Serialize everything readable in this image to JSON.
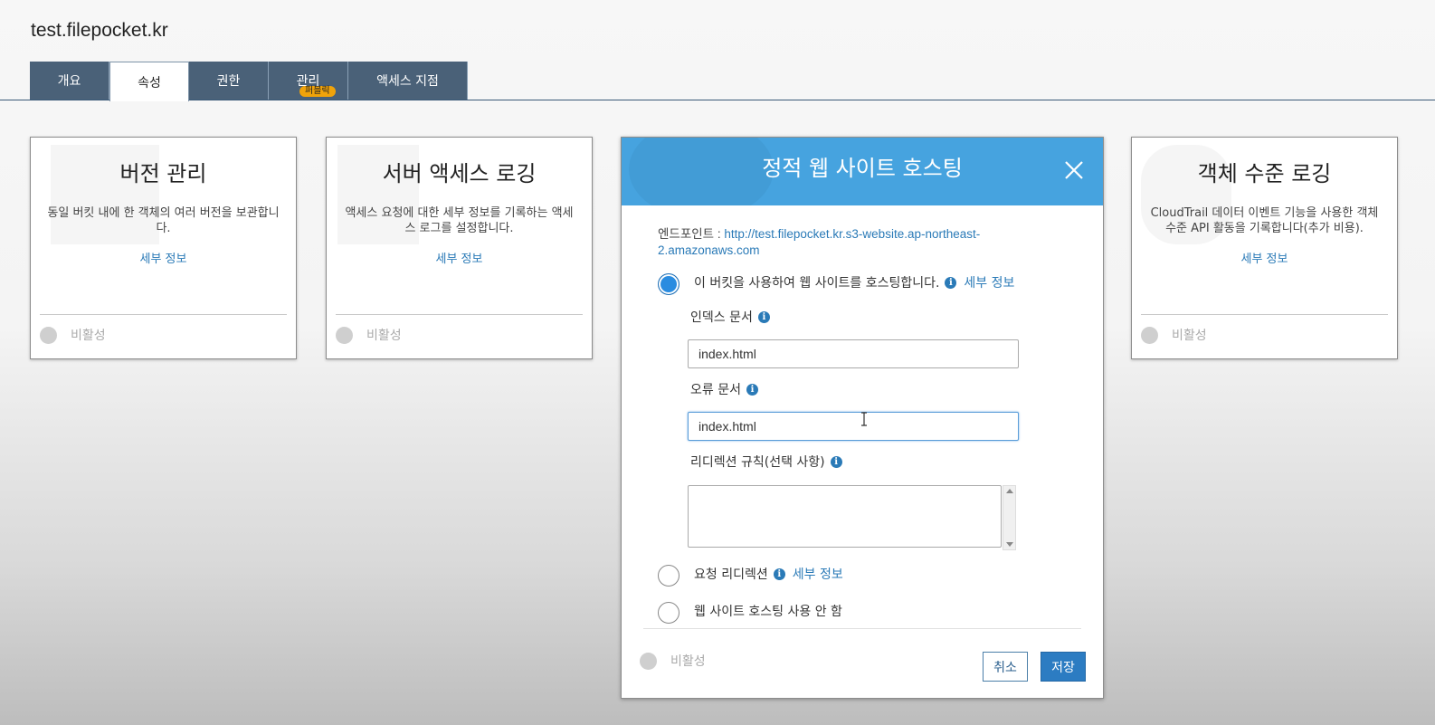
{
  "bucket": {
    "title": "test.filepocket.kr"
  },
  "tabs": [
    {
      "label": "개요",
      "active": false
    },
    {
      "label": "속성",
      "active": true
    },
    {
      "label": "권한",
      "active": false
    },
    {
      "label": "관리",
      "active": false,
      "badge": "퍼블릭"
    },
    {
      "label": "액세스 지점",
      "active": false
    }
  ],
  "cards": {
    "versioning": {
      "title": "버전 관리",
      "desc": "동일 버킷 내에 한 객체의 여러 버전을 보관합니다.",
      "more": "세부 정보",
      "status": "비활성"
    },
    "logging": {
      "title": "서버 액세스 로깅",
      "desc": "액세스 요청에 대한 세부 정보를 기록하는 액세스 로그를 설정합니다.",
      "more": "세부 정보",
      "status": "비활성"
    },
    "object_logging": {
      "title": "객체 수준 로깅",
      "desc": "CloudTrail 데이터 이벤트 기능을 사용한 객체 수준 API 활동을 기록합니다(추가 비용).",
      "more": "세부 정보",
      "status": "비활성"
    }
  },
  "hosting": {
    "title": "정적 웹 사이트 호스팅",
    "endpoint_label": "엔드포인트 : ",
    "endpoint_url": "http://test.filepocket.kr.s3-website.ap-northeast-2.amazonaws.com",
    "option_host": "이 버킷을 사용하여 웹 사이트를 호스팅합니다.",
    "more": "세부 정보",
    "index_label": "인덱스 문서",
    "index_value": "index.html",
    "error_label": "오류 문서",
    "error_value": "index.html",
    "redirect_rules_label": "리디렉션 규칙(선택 사항)",
    "option_redirect": "요청 리디렉션",
    "option_disable": "웹 사이트 호스팅 사용 안 함",
    "status": "비활성",
    "cancel": "취소",
    "save": "저장",
    "info_glyph": "i"
  }
}
